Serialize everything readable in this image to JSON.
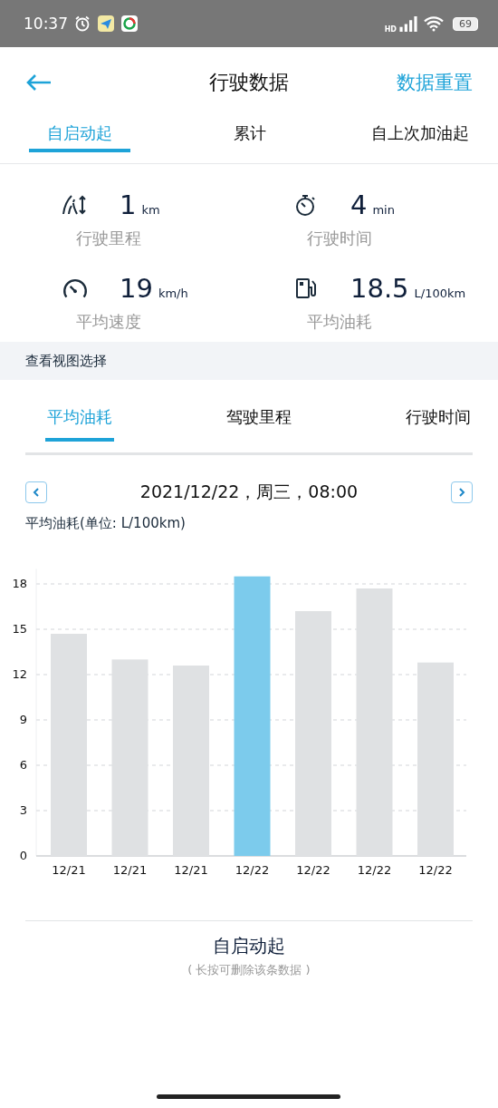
{
  "status_bar": {
    "time": "10:37",
    "battery": "69",
    "network": "HD"
  },
  "header": {
    "title": "行驶数据",
    "action": "数据重置"
  },
  "tabs": [
    {
      "label": "自启动起",
      "selected": true
    },
    {
      "label": "累计",
      "selected": false
    },
    {
      "label": "自上次加油起",
      "selected": false
    }
  ],
  "stats": [
    {
      "kind": "distance",
      "value": "1",
      "unit": "km",
      "label": "行驶里程"
    },
    {
      "kind": "time",
      "value": "4",
      "unit": "min",
      "label": "行驶时间"
    },
    {
      "kind": "speed",
      "value": "19",
      "unit": "km/h",
      "label": "平均速度"
    },
    {
      "kind": "fuel",
      "value": "18.5",
      "unit": "L/100km",
      "label": "平均油耗"
    }
  ],
  "section_title": "查看视图选择",
  "view_tabs": [
    {
      "label": "平均油耗",
      "selected": true
    },
    {
      "label": "驾驶里程",
      "selected": false
    },
    {
      "label": "行驶时间",
      "selected": false
    }
  ],
  "chart": {
    "date": "2021/12/22，周三，08:00",
    "unit_suffix": "(单位: L/100km)",
    "bars": [
      {
        "selected": false
      },
      {
        "selected": false
      },
      {
        "selected": false
      },
      {
        "selected": true
      },
      {
        "selected": false
      },
      {
        "selected": false
      },
      {
        "selected": false
      }
    ],
    "chart_data": {
      "type": "bar",
      "categories": [
        "12/21",
        "12/21",
        "12/21",
        "12/22",
        "12/22",
        "12/22",
        "12/22"
      ],
      "series": [
        {
          "name": "平均油耗",
          "values": [
            14.7,
            13.0,
            12.6,
            18.5,
            16.2,
            17.7,
            12.8
          ]
        }
      ],
      "ylim": [
        0,
        19
      ],
      "yticks": [
        0,
        3,
        6,
        9,
        12,
        15,
        18
      ],
      "grid": true
    }
  },
  "footer": {
    "title": "自启动起",
    "hint": "( 长按可删除该条数据 )"
  }
}
